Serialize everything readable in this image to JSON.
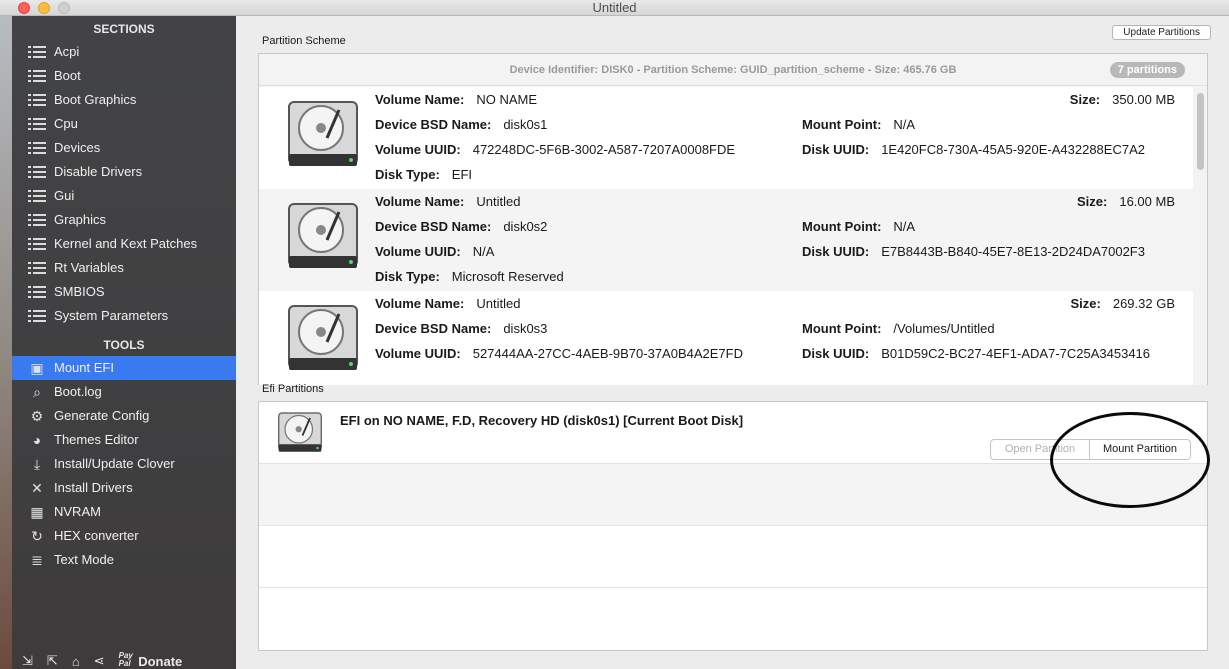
{
  "window": {
    "title": "Untitled"
  },
  "sidebar": {
    "sections_header": "SECTIONS",
    "sections": [
      "Acpi",
      "Boot",
      "Boot Graphics",
      "Cpu",
      "Devices",
      "Disable Drivers",
      "Gui",
      "Graphics",
      "Kernel and Kext Patches",
      "Rt Variables",
      "SMBIOS",
      "System Parameters"
    ],
    "tools_header": "TOOLS",
    "tools": [
      {
        "label": "Mount EFI",
        "icon": "disk-icon",
        "selected": true
      },
      {
        "label": "Boot.log",
        "icon": "log-search-icon"
      },
      {
        "label": "Generate Config",
        "icon": "gears-icon"
      },
      {
        "label": "Themes Editor",
        "icon": "palette-icon"
      },
      {
        "label": "Install/Update Clover",
        "icon": "download-icon"
      },
      {
        "label": "Install Drivers",
        "icon": "tools-icon"
      },
      {
        "label": "NVRAM",
        "icon": "chip-icon"
      },
      {
        "label": "HEX converter",
        "icon": "refresh-icon"
      },
      {
        "label": "Text Mode",
        "icon": "text-icon"
      }
    ],
    "bottom": {
      "donate_label": "Donate",
      "paypal_label": "Pay Pal"
    }
  },
  "main": {
    "update_button": "Update Partitions",
    "partition_scheme_label": "Partition Scheme",
    "scheme_header": "Device Identifier: DISK0 - Partition Scheme: GUID_partition_scheme - Size: 465.76 GB",
    "partition_count": "7 partitions",
    "field_labels": {
      "volume_name": "Volume Name:",
      "bsd_name": "Device BSD Name:",
      "volume_uuid": "Volume UUID:",
      "disk_type": "Disk Type:",
      "size": "Size:",
      "mount_point": "Mount Point:",
      "disk_uuid": "Disk UUID:"
    },
    "partitions": [
      {
        "volume_name": "NO NAME",
        "bsd_name": "disk0s1",
        "volume_uuid": "472248DC-5F6B-3002-A587-7207A0008FDE",
        "disk_type": "EFI",
        "size": "350.00 MB",
        "mount_point": "N/A",
        "disk_uuid": "1E420FC8-730A-45A5-920E-A432288EC7A2"
      },
      {
        "volume_name": "Untitled",
        "bsd_name": "disk0s2",
        "volume_uuid": "N/A",
        "disk_type": "Microsoft Reserved",
        "size": "16.00 MB",
        "mount_point": "N/A",
        "disk_uuid": "E7B8443B-B840-45E7-8E13-2D24DA7002F3"
      },
      {
        "volume_name": "Untitled",
        "bsd_name": "disk0s3",
        "volume_uuid": "527444AA-27CC-4AEB-9B70-37A0B4A2E7FD",
        "disk_type": "",
        "size": "269.32 GB",
        "mount_point": "/Volumes/Untitled",
        "disk_uuid": "B01D59C2-BC27-4EF1-ADA7-7C25A3453416"
      }
    ],
    "efi_label": "Efi Partitions",
    "efi_partitions": [
      {
        "title": "EFI on NO NAME, F.D, Recovery HD (disk0s1) [Current Boot Disk]",
        "open_label": "Open Partition",
        "mount_label": "Mount Partition"
      }
    ]
  }
}
